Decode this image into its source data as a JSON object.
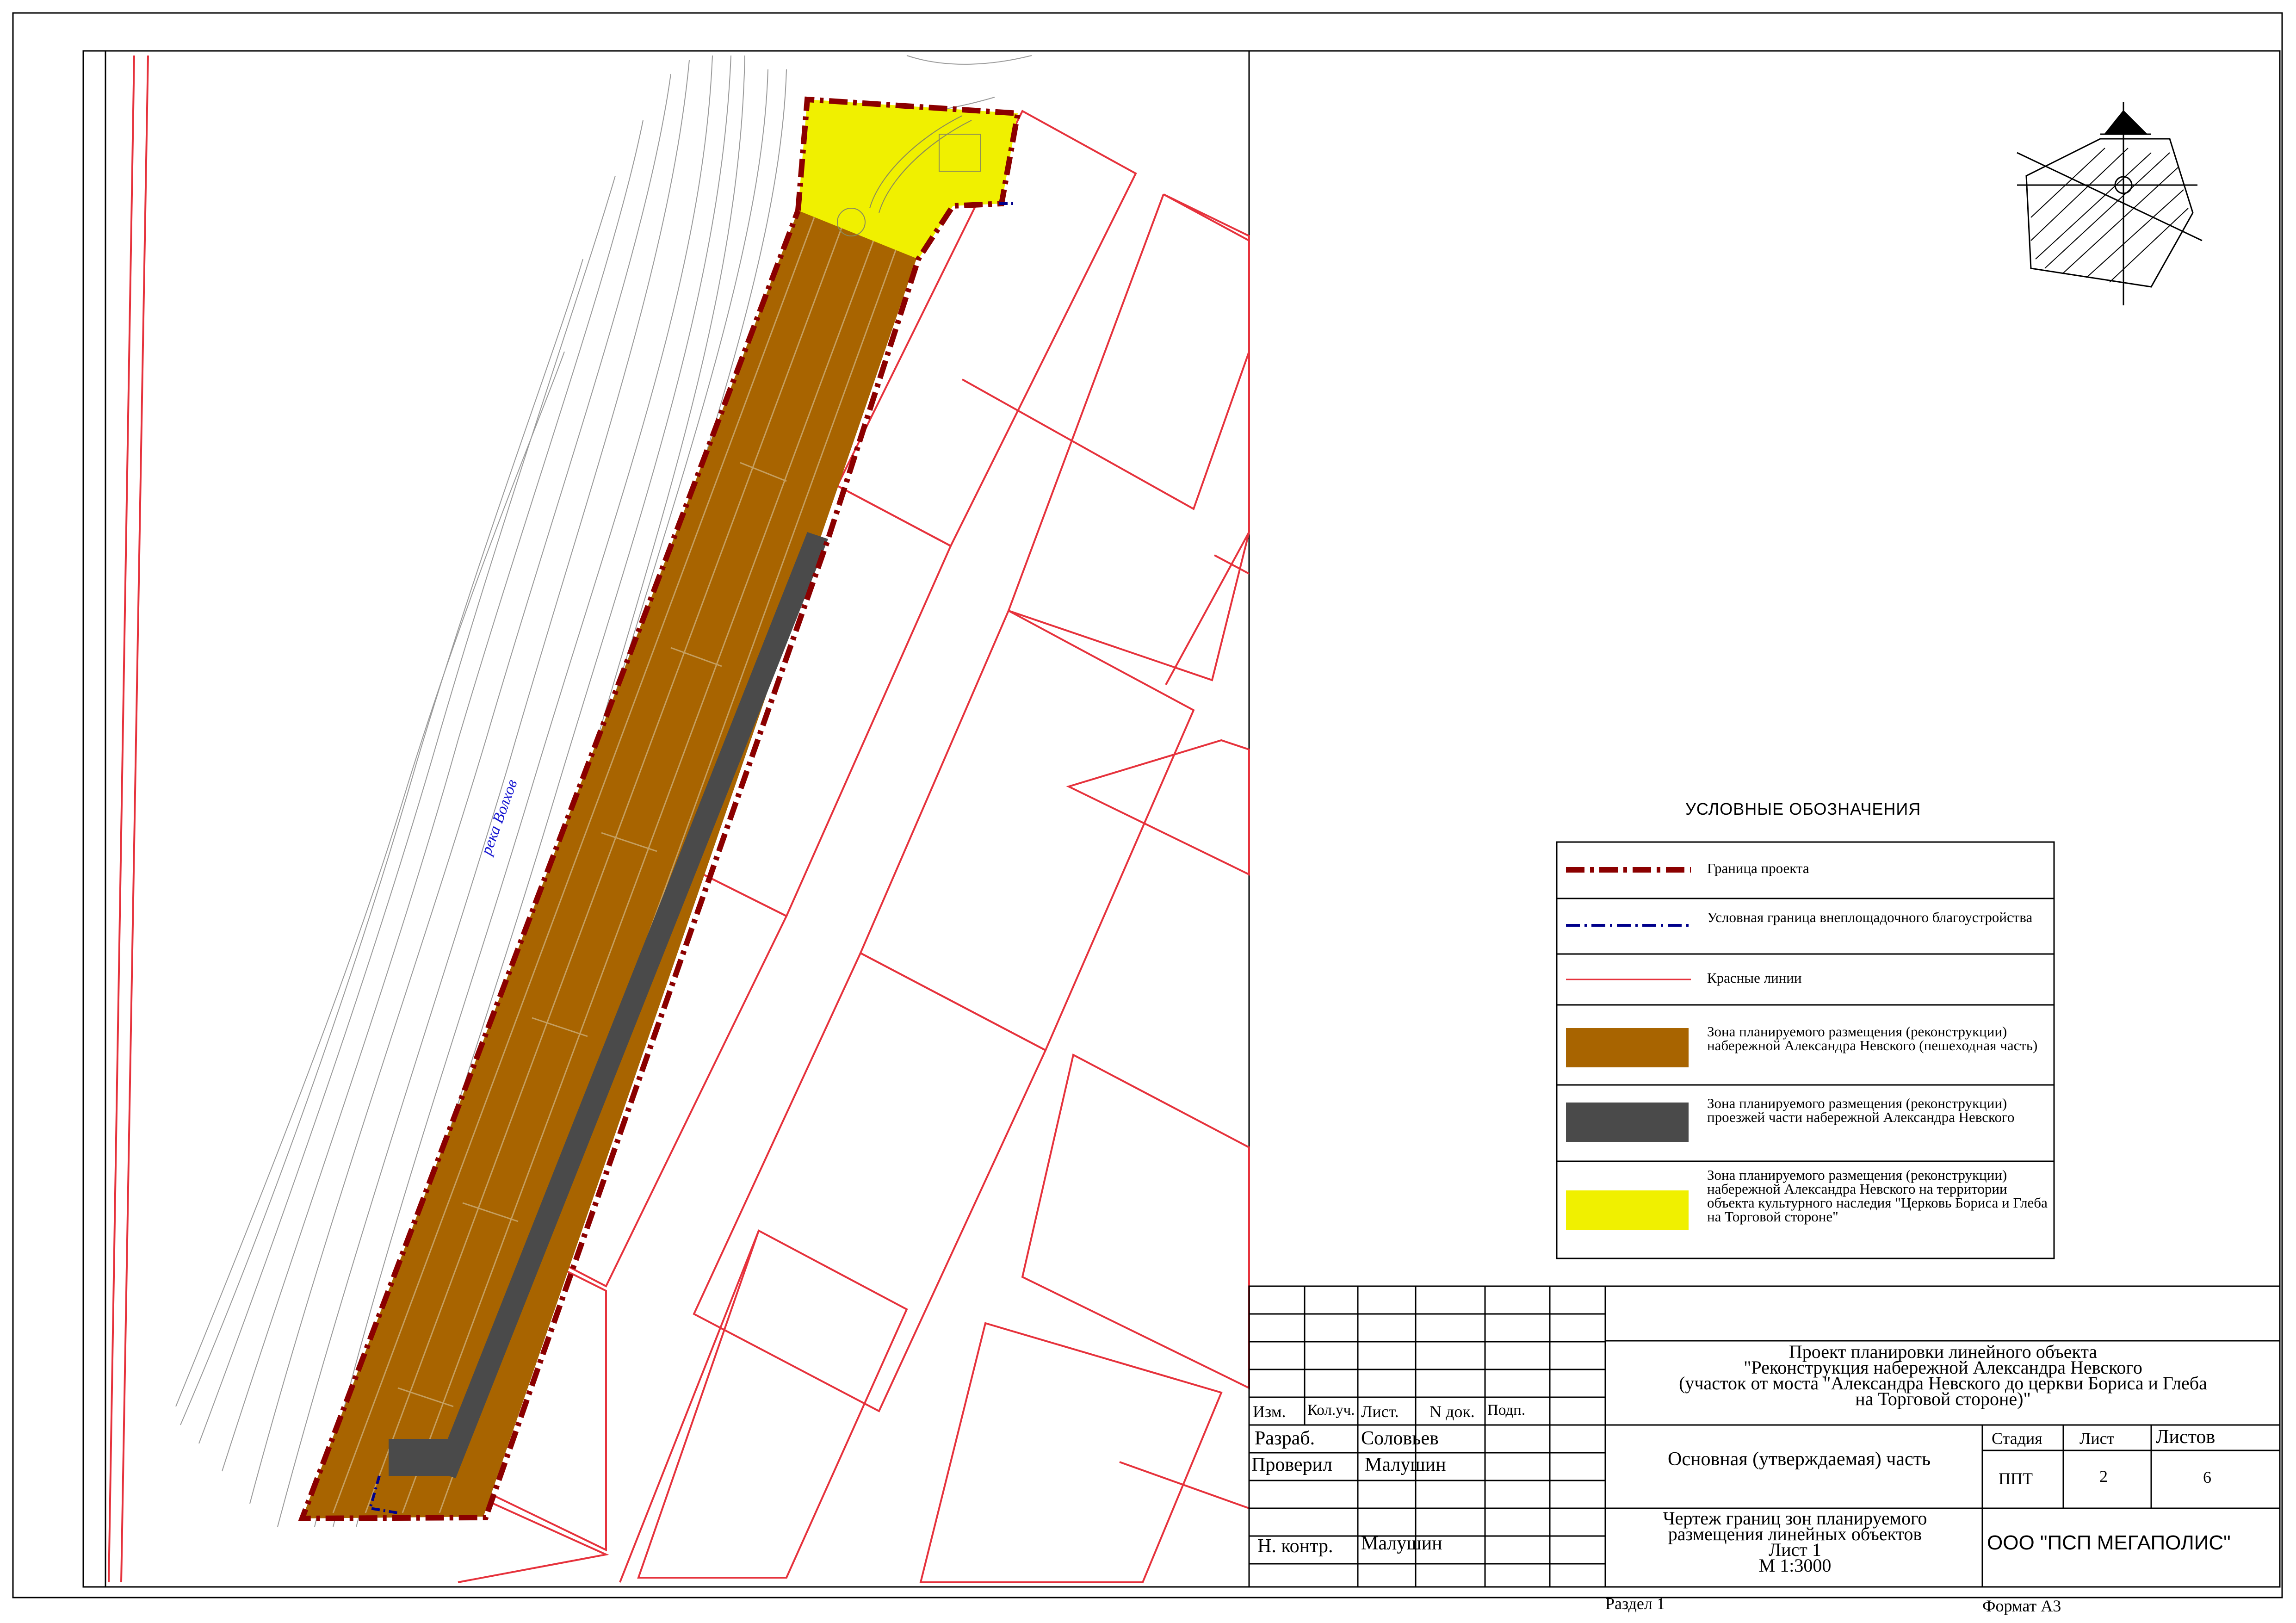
{
  "map": {
    "river_label": "река Волхов"
  },
  "legend": {
    "title": "УСЛОВНЫЕ ОБОЗНАЧЕНИЯ",
    "items": [
      {
        "label": "Граница проекта",
        "color": "#8b0000"
      },
      {
        "label": "Условная граница внеплощадочного благоустройства",
        "color": "#00008b"
      },
      {
        "label": "Красные линии",
        "color": "#e6323c"
      },
      {
        "label": "Зона планируемого размещения (реконструкции) набережной Александра Невского (пешеходная часть)",
        "color": "#a86400"
      },
      {
        "label": "Зона планируемого размещения (реконструкции) проезжей части набережной Александра Невского",
        "color": "#4a4a4a"
      },
      {
        "label": "Зона планируемого размещения (реконструкции) набережной Александра Невского на территории объекта культурного наследия \"Церковь Бориса и Глеба на Торговой стороне\"",
        "color": "#f0f000"
      }
    ]
  },
  "title_block": {
    "project_title_lines": [
      "Проект планировки линейного объекта",
      "\"Реконструкция набережной Александра Невского",
      "(участок от моста \"Александра Невского до церкви Бориса и Глеба",
      "на Торговой стороне)\""
    ],
    "headers": {
      "izm": "Изм.",
      "kol": "Кол.уч.",
      "list": "Лист.",
      "ndok": "N док.",
      "podp": "Подп."
    },
    "razrab_label": "Разраб.",
    "razrab_name": "Соловьев",
    "proveril_label": "Проверил",
    "proveril_name": "Малушин",
    "nkontr_label": "Н. контр.",
    "nkontr_name": "Малушин",
    "part_name": "Основная (утверждаемая) часть",
    "stage_label": "Стадия",
    "sheet_label": "Лист",
    "sheets_label": "Листов",
    "stage_value": "ППТ",
    "sheet_value": "2",
    "sheets_value": "6",
    "drawing_title_lines": [
      "Чертеж границ зон планируемого",
      "размещения линейных объектов",
      "Лист 1",
      "М 1:3000"
    ],
    "company": "ООО \"ПСП МЕГАПОЛИС\""
  },
  "footer": {
    "section": "Раздел 1",
    "format": "Формат А3"
  }
}
